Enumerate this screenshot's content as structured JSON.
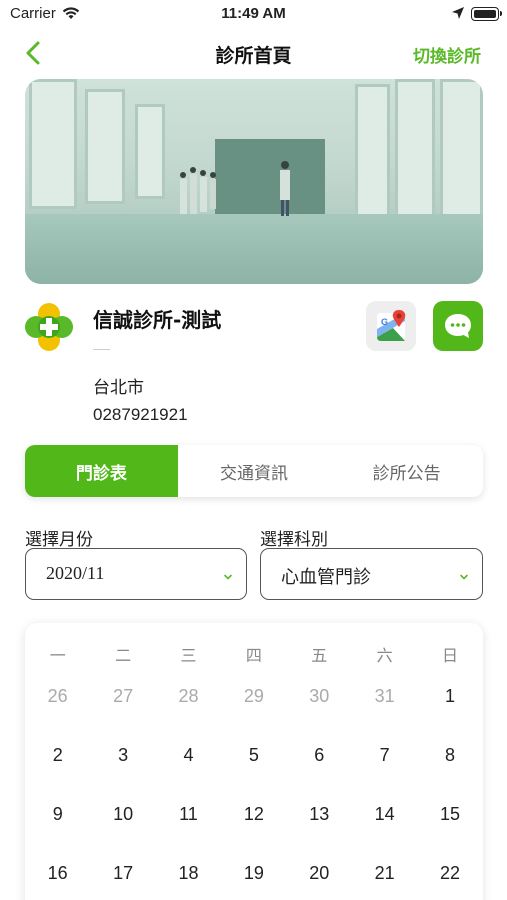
{
  "status_bar": {
    "carrier": "Carrier",
    "time": "11:49 AM"
  },
  "nav": {
    "title": "診所首頁",
    "switch_label": "切換診所"
  },
  "clinic": {
    "name": "信誠診所-測試",
    "city": "台北市",
    "phone": "0287921921"
  },
  "tabs": [
    {
      "label": "門診表",
      "active": true
    },
    {
      "label": "交通資訊",
      "active": false
    },
    {
      "label": "診所公告",
      "active": false
    }
  ],
  "filters": {
    "month_label": "選擇月份",
    "month_value": "2020/11",
    "dept_label": "選擇科別",
    "dept_value": "心血管門診"
  },
  "calendar": {
    "weekdays": [
      "一",
      "二",
      "三",
      "四",
      "五",
      "六",
      "日"
    ],
    "weeks": [
      [
        "26",
        "27",
        "28",
        "29",
        "30",
        "31",
        "1"
      ],
      [
        "2",
        "3",
        "4",
        "5",
        "6",
        "7",
        "8"
      ],
      [
        "9",
        "10",
        "11",
        "12",
        "13",
        "14",
        "15"
      ],
      [
        "16",
        "17",
        "18",
        "19",
        "20",
        "21",
        "22"
      ]
    ],
    "muted_first_week_count": 6
  },
  "colors": {
    "accent": "#52b81a",
    "accent_text": "#5ab929"
  },
  "icons": {
    "back": "chevron-left-icon",
    "map": "google-maps-icon",
    "message": "chat-bubble-icon"
  }
}
